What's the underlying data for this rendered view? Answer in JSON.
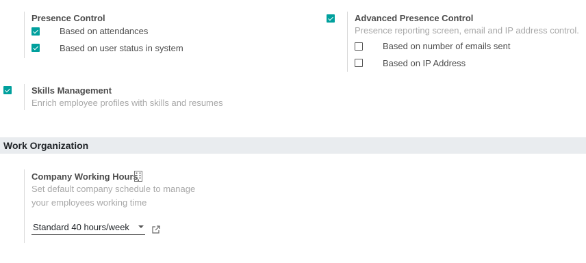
{
  "presence_control": {
    "title": "Presence Control",
    "options": [
      {
        "label": "Based on attendances",
        "checked": true
      },
      {
        "label": "Based on user status in system",
        "checked": true
      }
    ]
  },
  "advanced_presence": {
    "checked": true,
    "title": "Advanced Presence Control",
    "description": "Presence reporting screen, email and IP address control.",
    "options": [
      {
        "label": "Based on number of emails sent",
        "checked": false
      },
      {
        "label": "Based on IP Address",
        "checked": false
      }
    ]
  },
  "skills": {
    "checked": true,
    "title": "Skills Management",
    "description": "Enrich employee profiles with skills and resumes"
  },
  "section": {
    "title": "Work Organization"
  },
  "working_hours": {
    "title": "Company Working Hours",
    "icon": "building-icon",
    "description_line1": "Set default company schedule to manage",
    "description_line2": "your employees working time",
    "selected": "Standard 40 hours/week",
    "external_link_icon": "external-link-icon"
  },
  "colors": {
    "accent": "#00a09d",
    "section_bg": "#e9ecef",
    "muted_text": "#a8a8a8"
  }
}
